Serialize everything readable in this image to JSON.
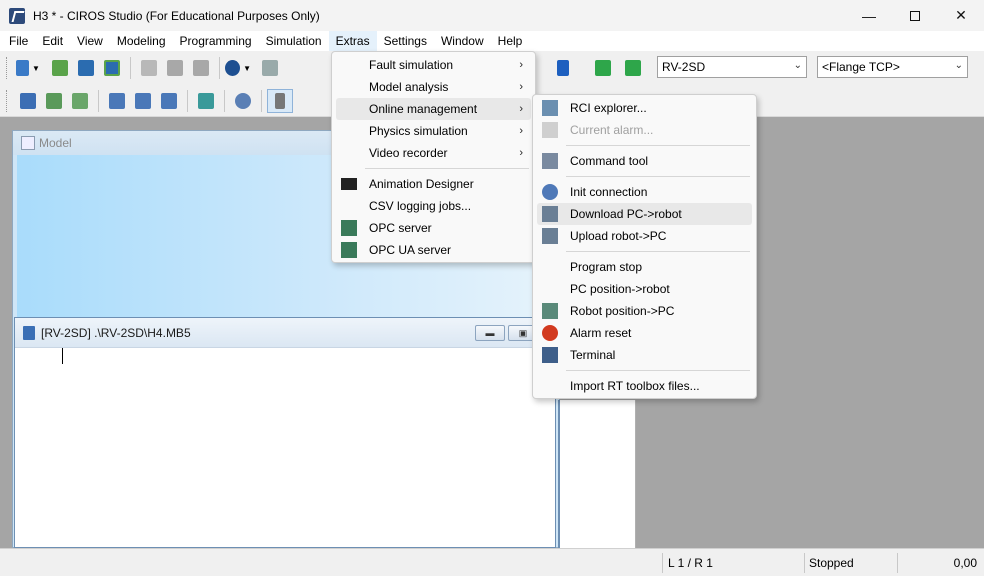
{
  "window": {
    "title": "H3 * - CIROS Studio (For Educational Purposes Only)",
    "minimize_icon": "minimize-icon",
    "maximize_icon": "maximize-icon",
    "close_icon": "close-icon"
  },
  "menubar": {
    "items": [
      "File",
      "Edit",
      "View",
      "Modeling",
      "Programming",
      "Simulation",
      "Extras",
      "Settings",
      "Window",
      "Help"
    ],
    "active": "Extras"
  },
  "toolbar": {
    "robot_combo": "RV-2SD",
    "tcp_combo": "<Flange TCP>"
  },
  "model_window": {
    "title": "Model"
  },
  "editor_window": {
    "title": "[RV-2SD] .\\RV-2SD\\H4.MB5"
  },
  "statusbar": {
    "position": "L 1 / R 1",
    "state": "Stopped",
    "value": "0,00"
  },
  "extras_menu": {
    "items": [
      {
        "label": "Fault simulation",
        "submenu": true
      },
      {
        "label": "Model analysis",
        "submenu": true
      },
      {
        "label": "Online management",
        "submenu": true,
        "highlighted": true
      },
      {
        "label": "Physics simulation",
        "submenu": true
      },
      {
        "label": "Video recorder",
        "submenu": true
      },
      {
        "label": "Animation Designer",
        "icon": "clapperboard-icon"
      },
      {
        "label": "CSV logging jobs..."
      },
      {
        "label": "OPC server",
        "icon": "opc-server-icon"
      },
      {
        "label": "OPC UA server",
        "icon": "opc-ua-server-icon"
      }
    ]
  },
  "online_menu": {
    "items": [
      {
        "label": "RCI explorer...",
        "icon": "rci-explorer-icon"
      },
      {
        "label": "Current alarm...",
        "icon": "current-alarm-icon",
        "disabled": true
      },
      {
        "label": "Command tool",
        "icon": "command-tool-icon"
      },
      {
        "label": "Init connection",
        "icon": "init-connection-icon"
      },
      {
        "label": "Download PC->robot",
        "icon": "download-icon",
        "highlighted": true
      },
      {
        "label": "Upload robot->PC",
        "icon": "upload-icon"
      },
      {
        "label": "Program stop"
      },
      {
        "label": "PC position->robot"
      },
      {
        "label": "Robot position->PC",
        "icon": "robot-position-icon"
      },
      {
        "label": "Alarm reset",
        "icon": "alarm-reset-icon"
      },
      {
        "label": "Terminal",
        "icon": "terminal-icon"
      },
      {
        "label": "Import RT toolbox files..."
      }
    ]
  },
  "colors": {
    "accent": "#e5f1fb",
    "model_bg": "#a9dcfb",
    "workspace": "#a5a5a5"
  }
}
